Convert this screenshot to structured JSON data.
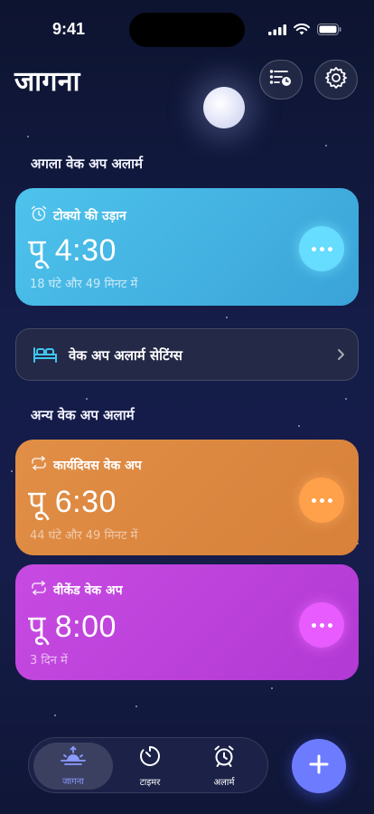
{
  "status": {
    "time": "9:41"
  },
  "header": {
    "title": "जागना",
    "list_button_icon": "list-clock-icon",
    "settings_button_icon": "gear-icon"
  },
  "next_alarm": {
    "section_label": "अगला वेक अप अलार्म",
    "name": "टोक्यो की उड़ान",
    "time": "पू 4:30",
    "remaining": "18 घंटे और 49 मिनट में",
    "color": "#4ec3ec"
  },
  "settings_row": {
    "label": "वेक अप अलार्म सेटिंग्स"
  },
  "other_alarms": {
    "section_label": "अन्य वेक अप अलार्म",
    "items": [
      {
        "name": "कार्यदिवस वेक अप",
        "time": "पू 6:30",
        "remaining": "44 घंटे और 49 मिनट में",
        "color": "#e18e46"
      },
      {
        "name": "वीकेंड वेक अप",
        "time": "पू 8:00",
        "remaining": "3 दिन में",
        "color": "#c74be2"
      }
    ]
  },
  "tabs": [
    {
      "label": "जागना",
      "icon": "sunrise-icon",
      "active": true
    },
    {
      "label": "टाइमर",
      "icon": "timer-icon",
      "active": false
    },
    {
      "label": "अलार्म",
      "icon": "alarm-clock-icon",
      "active": false
    }
  ],
  "fab": {
    "icon": "plus-icon"
  }
}
